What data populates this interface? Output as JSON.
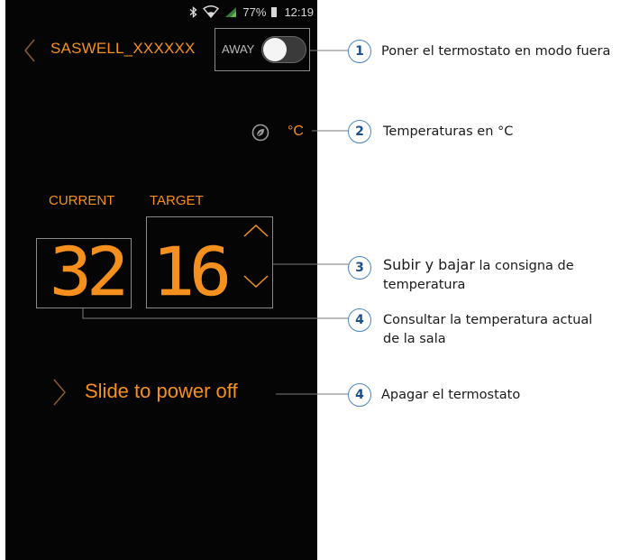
{
  "statusbar": {
    "battery_percent": "77%",
    "time": "12:19",
    "icons": [
      "bluetooth-icon",
      "wifi-icon",
      "signal-icon",
      "battery-icon"
    ]
  },
  "header": {
    "title": "SASWELL_XXXXXX",
    "away_label": "AWAY",
    "away_enabled": true
  },
  "units": {
    "label": "°C",
    "eco_icon": "leaf-icon"
  },
  "thermostat": {
    "current_label": "CURRENT",
    "target_label": "TARGET",
    "current_value": "32",
    "target_value": "16"
  },
  "power": {
    "label": "Slide to power off"
  },
  "annotations": [
    {
      "number": "1",
      "text": "Poner el termostato en modo fuera"
    },
    {
      "number": "2",
      "text": "Temperaturas en °C"
    },
    {
      "number": "3",
      "text_highlight": "Subir y bajar",
      "text_rest": " la consigna de temperatura"
    },
    {
      "number": "4",
      "text": "Consultar la temperatura actual de la sala"
    },
    {
      "number": "4",
      "text": "Apagar el termostato"
    }
  ],
  "colors": {
    "accent": "#f5901e",
    "phone_bg": "#050505",
    "badge_border": "#4a86c4",
    "badge_text": "#1d4f8c"
  }
}
